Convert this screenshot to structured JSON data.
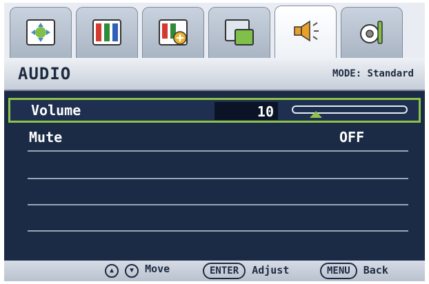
{
  "tabs": [
    {
      "icon": "display-adjust-icon"
    },
    {
      "icon": "picture-color-icon"
    },
    {
      "icon": "picture-advanced-icon"
    },
    {
      "icon": "pip-icon"
    },
    {
      "icon": "audio-speaker-icon",
      "active": true
    },
    {
      "icon": "system-settings-icon"
    }
  ],
  "header": {
    "title": "AUDIO",
    "mode": "MODE: Standard"
  },
  "rows": {
    "volume": {
      "label": "Volume",
      "value": "10",
      "level": 0.1
    },
    "mute": {
      "label": "Mute",
      "value": "OFF"
    }
  },
  "footer": {
    "move": "Move",
    "enter": "ENTER",
    "adjust": "Adjust",
    "menu": "MENU",
    "back": "Back"
  },
  "colors": {
    "accent": "#8dc34a",
    "panel": "#1b2a45"
  }
}
